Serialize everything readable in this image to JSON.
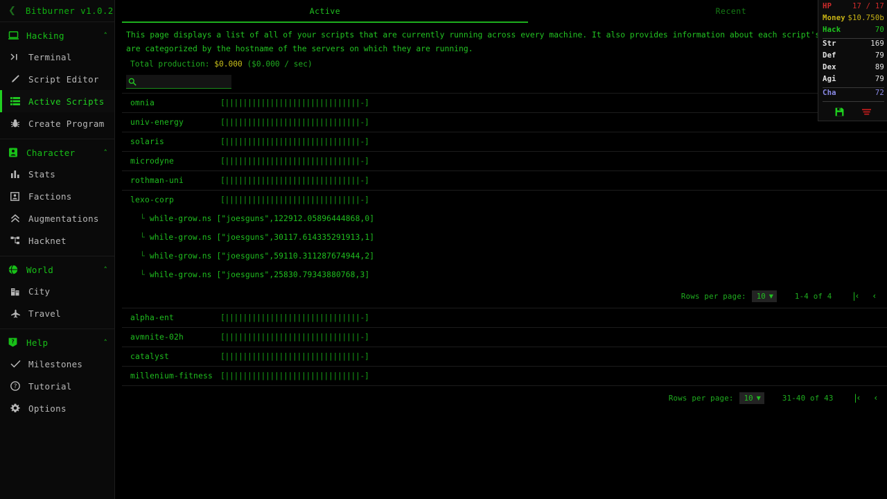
{
  "sidebar": {
    "collapse_icon": "chevron-left-icon",
    "title": "Bitburner v1.0.2",
    "groups": [
      {
        "category": {
          "label": "Hacking",
          "icon": "laptop-icon",
          "carat": "˄"
        },
        "items": [
          {
            "label": "Terminal",
            "icon": "terminal-icon"
          },
          {
            "label": "Script Editor",
            "icon": "pencil-icon"
          },
          {
            "label": "Active Scripts",
            "icon": "list-icon",
            "selected": true
          },
          {
            "label": "Create Program",
            "icon": "bug-icon"
          }
        ]
      },
      {
        "category": {
          "label": "Character",
          "icon": "person-badge-icon",
          "carat": "˄"
        },
        "items": [
          {
            "label": "Stats",
            "icon": "bar-chart-icon"
          },
          {
            "label": "Factions",
            "icon": "id-card-icon"
          },
          {
            "label": "Augmentations",
            "icon": "double-chevron-up-icon"
          },
          {
            "label": "Hacknet",
            "icon": "network-icon"
          }
        ]
      },
      {
        "category": {
          "label": "World",
          "icon": "globe-icon",
          "carat": "˄"
        },
        "items": [
          {
            "label": "City",
            "icon": "building-icon"
          },
          {
            "label": "Travel",
            "icon": "airplane-icon"
          }
        ]
      },
      {
        "category": {
          "label": "Help",
          "icon": "help-square-icon",
          "carat": "˄"
        },
        "items": [
          {
            "label": "Milestones",
            "icon": "check-icon"
          },
          {
            "label": "Tutorial",
            "icon": "question-circle-icon"
          },
          {
            "label": "Options",
            "icon": "gear-icon"
          }
        ]
      }
    ]
  },
  "tabs": [
    {
      "label": "Active",
      "active": true
    },
    {
      "label": "Recent",
      "active": false
    }
  ],
  "description": "This page displays a list of all of your scripts that are currently running across every machine. It also provides information about each script's production. The scripts are categorized by the hostname of the servers on which they are running.",
  "description_line1": "This page displays a list of all of your scripts that are currently running across every machine. It also provides information about each script's production. The scripts",
  "description_line2": "are categorized by the hostname of the servers on which they are running.",
  "production": {
    "label": "Total production:",
    "amount": "$0.000",
    "rate": "($0.000 / sec)"
  },
  "search": {
    "icon": "search-icon",
    "value": "",
    "placeholder": ""
  },
  "rows": [
    {
      "host": "omnia",
      "bar": "[||||||||||||||||||||||||||||||-]",
      "chevron": "˅",
      "expanded": false
    },
    {
      "host": "univ-energy",
      "bar": "[||||||||||||||||||||||||||||||-]",
      "chevron": "˅",
      "expanded": false
    },
    {
      "host": "solaris",
      "bar": "[||||||||||||||||||||||||||||||-]",
      "chevron": "˅",
      "expanded": false,
      "eye_icon": "eye-slash-icon"
    },
    {
      "host": "microdyne",
      "bar": "[||||||||||||||||||||||||||||||-]",
      "chevron": "˅",
      "expanded": false
    },
    {
      "host": "rothman-uni",
      "bar": "[||||||||||||||||||||||||||||||-]",
      "chevron": "˅",
      "expanded": false
    },
    {
      "host": "lexo-corp",
      "bar": "[||||||||||||||||||||||||||||||-]",
      "chevron": "˄",
      "expanded": true
    },
    {
      "host": "alpha-ent",
      "bar": "[||||||||||||||||||||||||||||||-]",
      "chevron": "˅",
      "expanded": false
    },
    {
      "host": "avmnite-02h",
      "bar": "[||||||||||||||||||||||||||||||-]",
      "chevron": "˅",
      "expanded": false
    },
    {
      "host": "catalyst",
      "bar": "[||||||||||||||||||||||||||||||-]",
      "chevron": "˅",
      "expanded": false
    },
    {
      "host": "millenium-fitness",
      "bar": "[||||||||||||||||||||||||||||||-]",
      "chevron": "˅",
      "expanded": false
    }
  ],
  "expanded_scripts": [
    {
      "prefix": "└",
      "name": "while-grow.ns",
      "args": "[\"joesguns\",122912.05896444868,0]",
      "chevron": "˅"
    },
    {
      "prefix": "└",
      "name": "while-grow.ns",
      "args": "[\"joesguns\",30117.614335291913,1]",
      "chevron": "˅"
    },
    {
      "prefix": "└",
      "name": "while-grow.ns",
      "args": "[\"joesguns\",59110.311287674944,2]",
      "chevron": "˅"
    },
    {
      "prefix": "└",
      "name": "while-grow.ns",
      "args": "[\"joesguns\",25830.79343880768,3]",
      "chevron": "˅"
    }
  ],
  "inner_pagination": {
    "rows_label": "Rows per page:",
    "rows_value": "10",
    "range": "1-4 of 4",
    "first": "|‹",
    "prev": "‹",
    "next": "›",
    "last": "›|"
  },
  "outer_pagination": {
    "rows_label": "Rows per page:",
    "rows_value": "10",
    "range": "31-40 of 43",
    "first": "|‹",
    "prev": "‹",
    "next": "›",
    "last": "›|"
  },
  "stats": {
    "hp": {
      "key": "HP",
      "value": "17 / 17"
    },
    "money": {
      "key": "Money",
      "value": "$10.750b"
    },
    "hack": {
      "key": "Hack",
      "value": "70"
    },
    "str": {
      "key": "Str",
      "value": "169"
    },
    "def": {
      "key": "Def",
      "value": "79"
    },
    "dex": {
      "key": "Dex",
      "value": "89"
    },
    "agi": {
      "key": "Agi",
      "value": "79"
    },
    "cha": {
      "key": "Cha",
      "value": "72"
    },
    "save_icon": "save-floppy-icon",
    "speed_icon": "fast-forward-icon"
  },
  "colors": {
    "accent_green": "#1eb01e",
    "bright_green": "#21d021",
    "hp_red": "#cf2b2b",
    "money_yellow": "#c9b415",
    "cha_purple": "#8a8ae8",
    "background": "#000000"
  }
}
